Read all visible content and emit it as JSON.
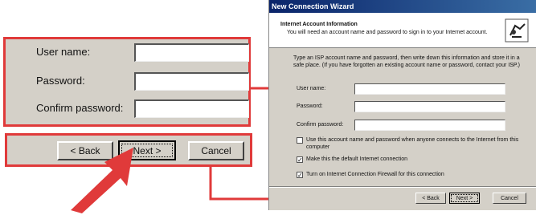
{
  "zoom": {
    "fields": [
      "User name:",
      "Password:",
      "Confirm password:"
    ],
    "buttons": {
      "back": "< Back",
      "next": "Next >",
      "cancel": "Cancel"
    }
  },
  "wizard": {
    "title": "New Connection Wizard",
    "header_title": "Internet Account Information",
    "header_subtitle": "You will need an account name and password to sign in to your Internet account.",
    "instructions": "Type an ISP account name and password, then write down this information and store it in a safe place. (If you have forgotten an existing account name or password, contact your ISP.)",
    "fields": [
      "User name:",
      "Password:",
      "Confirm password:"
    ],
    "checkboxes": [
      {
        "label": "Use this account name and password when anyone connects to the Internet from this computer",
        "checked": false
      },
      {
        "label": "Make this the default Internet connection",
        "checked": true
      },
      {
        "label": "Turn on Internet Connection Firewall for this connection",
        "checked": true
      }
    ],
    "buttons": {
      "back": "< Back",
      "next": "Next >",
      "cancel": "Cancel"
    }
  },
  "colors": {
    "highlight": "#e03a3a",
    "titlebar": "#0a246a",
    "dialog": "#d4d0c8"
  }
}
